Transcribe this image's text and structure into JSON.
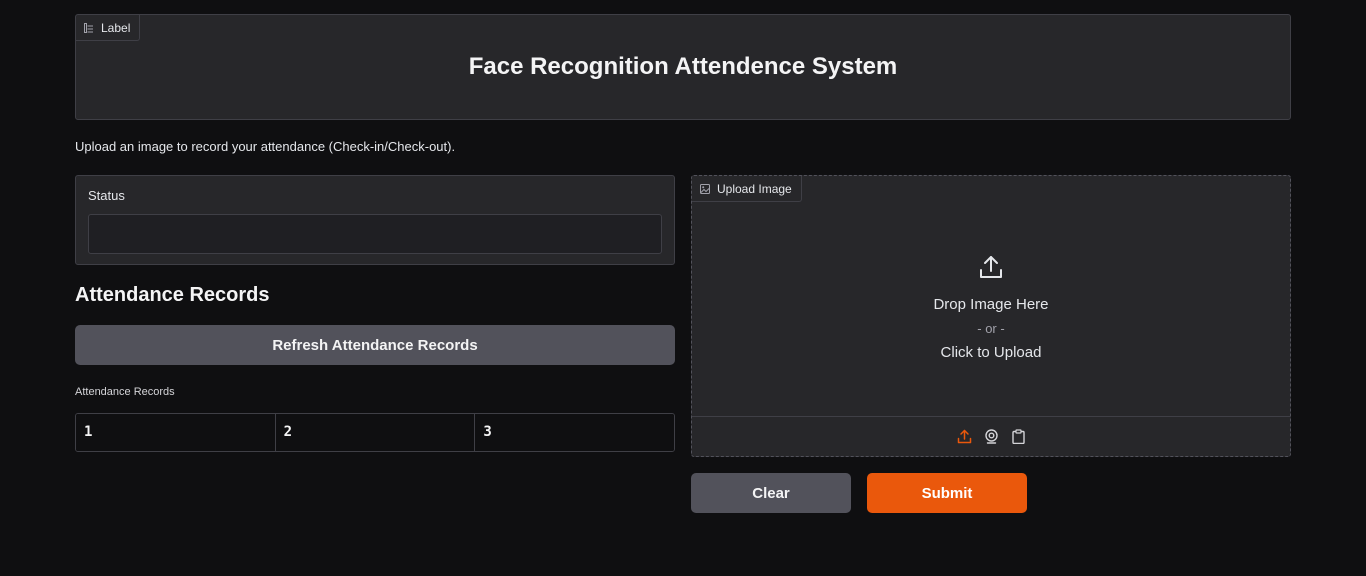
{
  "header": {
    "tag_label": "Label",
    "tag_icon": "label-icon",
    "title": "Face Recognition Attendence System"
  },
  "subtitle": "Upload an image to record your attendance (Check-in/Check-out).",
  "status": {
    "label": "Status",
    "value": ""
  },
  "records": {
    "heading": "Attendance Records",
    "refresh_label": "Refresh Attendance Records",
    "table_caption": "Attendance Records",
    "columns": [
      "1",
      "2",
      "3"
    ]
  },
  "upload": {
    "tag_label": "Upload Image",
    "tag_icon": "image-icon",
    "drop_text": "Drop Image Here",
    "or_text": "- or -",
    "click_text": "Click to Upload",
    "sources": [
      "upload-icon",
      "webcam-icon",
      "clipboard-icon"
    ],
    "active_source_color": "#ea580c"
  },
  "actions": {
    "clear_label": "Clear",
    "submit_label": "Submit"
  },
  "colors": {
    "background": "#0f0f11",
    "panel": "#27272a",
    "secondary_button": "#52525b",
    "primary_button": "#ea580c"
  }
}
